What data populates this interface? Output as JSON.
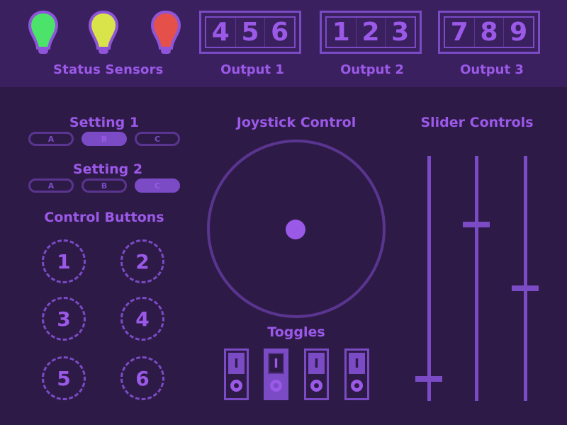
{
  "header": {
    "status_label": "Status Sensors",
    "sensors": [
      {
        "name": "sensor-1",
        "color": "#4be36a"
      },
      {
        "name": "sensor-2",
        "color": "#d8e44a"
      },
      {
        "name": "sensor-3",
        "color": "#e6504b"
      }
    ],
    "outputs": [
      {
        "label": "Output 1",
        "digits": [
          "4",
          "5",
          "6"
        ]
      },
      {
        "label": "Output 2",
        "digits": [
          "1",
          "2",
          "3"
        ]
      },
      {
        "label": "Output 3",
        "digits": [
          "7",
          "8",
          "9"
        ]
      }
    ]
  },
  "settings": [
    {
      "title": "Setting 1",
      "options": [
        "A",
        "B",
        "C"
      ],
      "selected": "B"
    },
    {
      "title": "Setting 2",
      "options": [
        "A",
        "B",
        "C"
      ],
      "selected": "C"
    }
  ],
  "control_buttons": {
    "title": "Control Buttons",
    "buttons": [
      "1",
      "2",
      "3",
      "4",
      "5",
      "6"
    ]
  },
  "joystick": {
    "title": "Joystick Control",
    "x": 0,
    "y": 0
  },
  "toggles": {
    "title": "Toggles",
    "items": [
      {
        "top": "I",
        "state": "off"
      },
      {
        "top": "I",
        "state": "on"
      },
      {
        "top": "I",
        "state": "off"
      },
      {
        "top": "I",
        "state": "off"
      }
    ]
  },
  "sliders": {
    "title": "Slider Controls",
    "values": [
      0.09,
      0.72,
      0.46
    ]
  },
  "colors": {
    "background": "#2e1a47",
    "header_bg": "#3b2060",
    "accent": "#9b59e8",
    "accent_dark": "#7a4bc5"
  }
}
